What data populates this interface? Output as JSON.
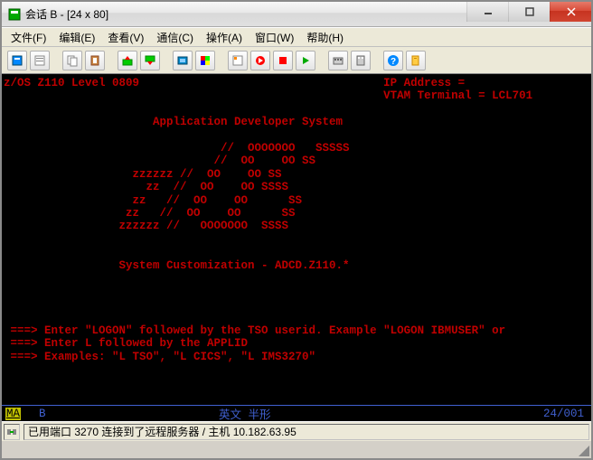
{
  "window": {
    "title": "会话 B - [24 x 80]"
  },
  "menus": {
    "file": "文件(F)",
    "edit": "编辑(E)",
    "view": "查看(V)",
    "comm": "通信(C)",
    "actions": "操作(A)",
    "window": "窗口(W)",
    "help": "帮助(H)"
  },
  "terminal": {
    "line01": "z/OS Z110 Level 0809                                    IP Address =",
    "line02": "                                                        VTAM Terminal = LCL701",
    "line03": "",
    "line04": "                      Application Developer System",
    "line05": "",
    "line06": "                                //  OOOOOOO   SSSSS",
    "line07": "                               //  OO    OO SS",
    "line08": "                   zzzzzz //  OO    OO SS",
    "line09": "                     zz  //  OO    OO SSSS",
    "line10": "                   zz   //  OO    OO      SS",
    "line11": "                  zz   //  OO    OO      SS",
    "line12": "                 zzzzzz //   OOOOOOO  SSSS",
    "line13": "",
    "line14": "",
    "line15": "                 System Customization - ADCD.Z110.*",
    "line16": "",
    "line17": "",
    "line18": "",
    "line19": "",
    "line20": " ===> Enter \"LOGON\" followed by the TSO userid. Example \"LOGON IBMUSER\" or",
    "line21": " ===> Enter L followed by the APPLID",
    "line22": " ===> Examples: \"L TSO\", \"L CICS\", \"L IMS3270\""
  },
  "oia": {
    "ma": "MA",
    "b": "B",
    "mode": "英文  半形",
    "pos": "24/001"
  },
  "statusbar": {
    "text": "已用端口 3270 连接到了远程服务器 / 主机 10.182.63.95"
  }
}
